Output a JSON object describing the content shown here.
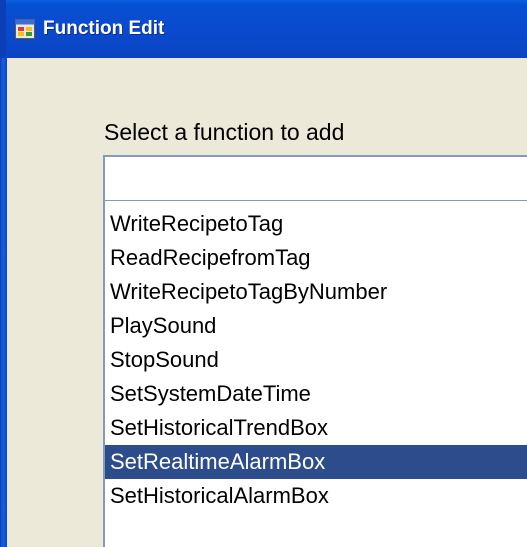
{
  "window": {
    "title": "Function Edit",
    "title_icon": "app-window-icon"
  },
  "dialog": {
    "prompt_label": "Select a function to add",
    "search_value": "",
    "functions": [
      {
        "label": "WriteRecipetoTag",
        "selected": false
      },
      {
        "label": "ReadRecipefromTag",
        "selected": false
      },
      {
        "label": "WriteRecipetoTagByNumber",
        "selected": false
      },
      {
        "label": "PlaySound",
        "selected": false
      },
      {
        "label": "StopSound",
        "selected": false
      },
      {
        "label": "SetSystemDateTime",
        "selected": false
      },
      {
        "label": "SetHistoricalTrendBox",
        "selected": false
      },
      {
        "label": "SetRealtimeAlarmBox",
        "selected": true
      },
      {
        "label": "SetHistoricalAlarmBox",
        "selected": false
      }
    ]
  },
  "colors": {
    "titlebar": "#0a47c8",
    "title_text": "#ffffff",
    "client_background": "#ece9d8",
    "selection_background": "#2d4c8c",
    "selection_text": "#ffffff",
    "field_border": "#7f9db9"
  }
}
